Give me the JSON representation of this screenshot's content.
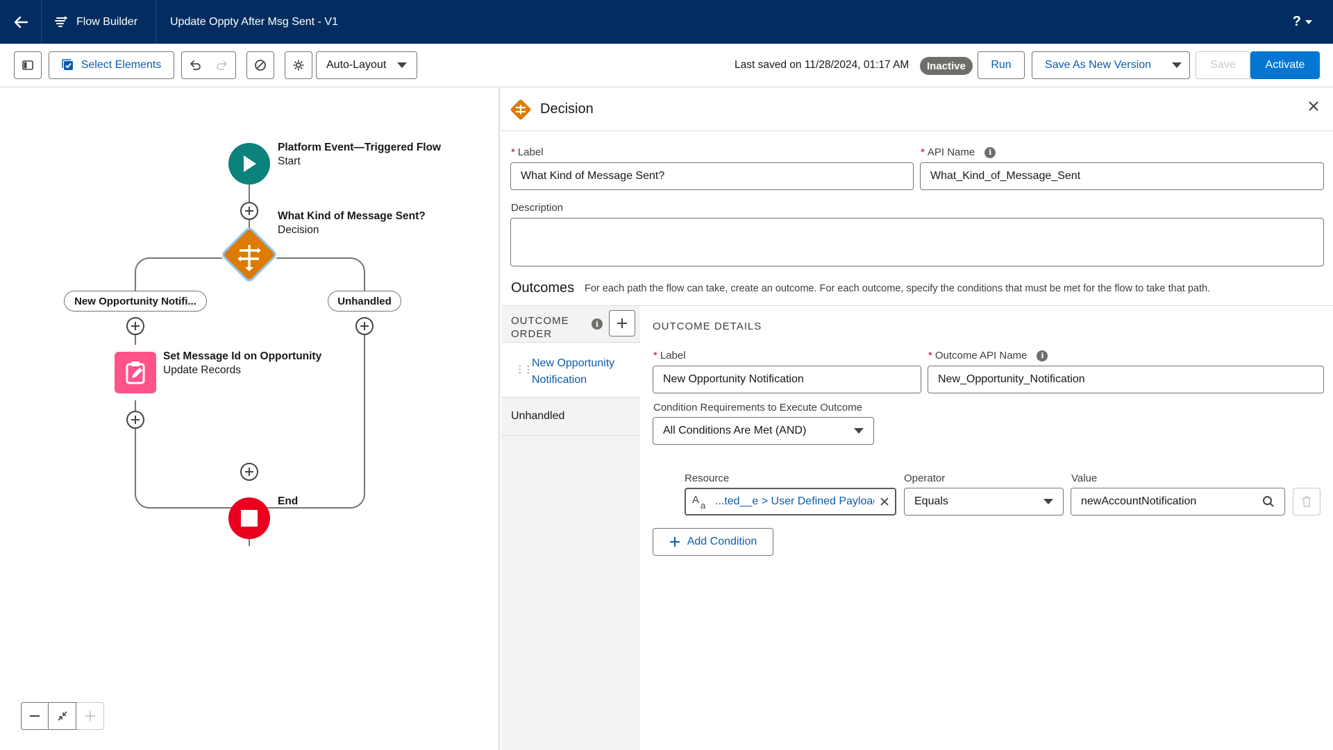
{
  "topbar": {
    "app_name": "Flow Builder",
    "flow_name": "Update Oppty After Msg Sent - V1",
    "help_label": "?"
  },
  "toolbar": {
    "select_elements_label": "Select Elements",
    "layout_mode": "Auto-Layout",
    "last_saved": "Last saved on 11/28/2024, 01:17 AM",
    "status_badge": "Inactive",
    "run_label": "Run",
    "save_as_label": "Save As New Version",
    "save_label": "Save",
    "activate_label": "Activate"
  },
  "canvas": {
    "start": {
      "title": "Platform Event—Triggered Flow",
      "subtitle": "Start"
    },
    "decision": {
      "title": "What Kind of Message Sent?",
      "subtitle": "Decision"
    },
    "branch_left": "New Opportunity Notifi...",
    "branch_right": "Unhandled",
    "update": {
      "title": "Set Message Id on Opportunity",
      "subtitle": "Update Records"
    },
    "end": {
      "title": "End"
    }
  },
  "panel": {
    "title": "Decision",
    "label_field": {
      "label": "Label",
      "value": "What Kind of Message Sent?"
    },
    "api_field": {
      "label": "API Name",
      "value": "What_Kind_of_Message_Sent"
    },
    "description_label": "Description",
    "outcomes_title": "Outcomes",
    "outcomes_desc": "For each path the flow can take, create an outcome. For each outcome, specify the conditions that must be met for the flow to take that path.",
    "outcome_order_line1": "OUTCOME",
    "outcome_order_line2": "ORDER",
    "outcome_items": [
      "New Opportunity Notification",
      "Unhandled"
    ],
    "outcome_details_title": "OUTCOME DETAILS",
    "outcome_label": {
      "label": "Label",
      "value": "New Opportunity Notification"
    },
    "outcome_api": {
      "label": "Outcome API Name",
      "value": "New_Opportunity_Notification"
    },
    "condition_req_label": "Condition Requirements to Execute Outcome",
    "condition_req_value": "All Conditions Are Met (AND)",
    "condition": {
      "resource_label": "Resource",
      "resource_value": "...ted__e > User Defined Payload",
      "operator_label": "Operator",
      "operator_value": "Equals",
      "value_label": "Value",
      "value_value": "newAccountNotification"
    },
    "add_condition_label": "Add Condition"
  },
  "colors": {
    "header_bg": "#032d60",
    "brand_blue": "#0176d3",
    "start_green": "#0b827c",
    "decision_orange": "#dd7a01",
    "update_pink": "#ff538a",
    "end_red": "#ea001e"
  }
}
